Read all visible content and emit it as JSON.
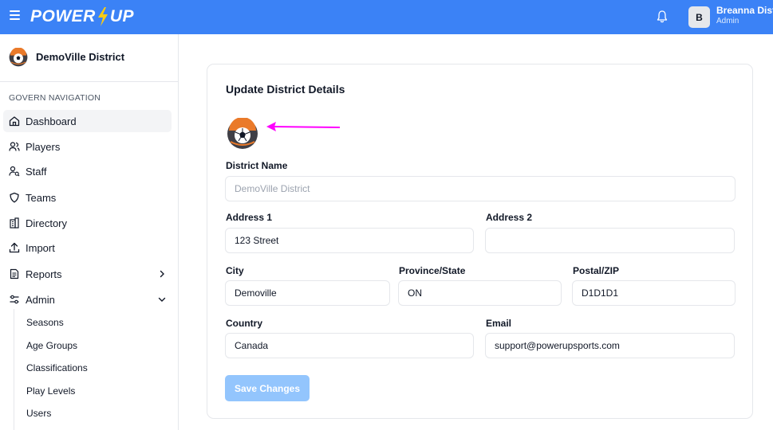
{
  "header": {
    "brand_left": "POWER",
    "brand_right": "UP",
    "user_initial": "B",
    "user_name": "Breanna Dist",
    "user_role": "Admin"
  },
  "sidebar": {
    "district_name": "DemoVille District",
    "nav_heading": "GOVERN NAVIGATION",
    "items": [
      {
        "label": "Dashboard",
        "icon": "home-icon"
      },
      {
        "label": "Players",
        "icon": "users-icon"
      },
      {
        "label": "Staff",
        "icon": "staff-icon"
      },
      {
        "label": "Teams",
        "icon": "shield-icon"
      },
      {
        "label": "Directory",
        "icon": "building-icon"
      },
      {
        "label": "Import",
        "icon": "upload-icon"
      },
      {
        "label": "Reports",
        "icon": "report-icon"
      },
      {
        "label": "Admin",
        "icon": "sliders-icon"
      }
    ],
    "admin_sub_items": [
      "Seasons",
      "Age Groups",
      "Classifications",
      "Play Levels",
      "Users"
    ]
  },
  "form": {
    "title": "Update District Details",
    "district_name_label": "District Name",
    "district_name_value": "DemoVille District",
    "address1_label": "Address 1",
    "address1_value": "123 Street",
    "address2_label": "Address 2",
    "address2_value": "",
    "city_label": "City",
    "city_value": "Demoville",
    "province_label": "Province/State",
    "province_value": "ON",
    "postal_label": "Postal/ZIP",
    "postal_value": "D1D1D1",
    "country_label": "Country",
    "country_value": "Canada",
    "email_label": "Email",
    "email_value": "support@powerupsports.com",
    "save_label": "Save Changes"
  },
  "colors": {
    "topbar": "#3b82f6",
    "bolt": "#facc15",
    "save_button": "#93c5fd",
    "annotation_arrow": "#ff00ff",
    "logo_orange": "#ea7a2a"
  }
}
